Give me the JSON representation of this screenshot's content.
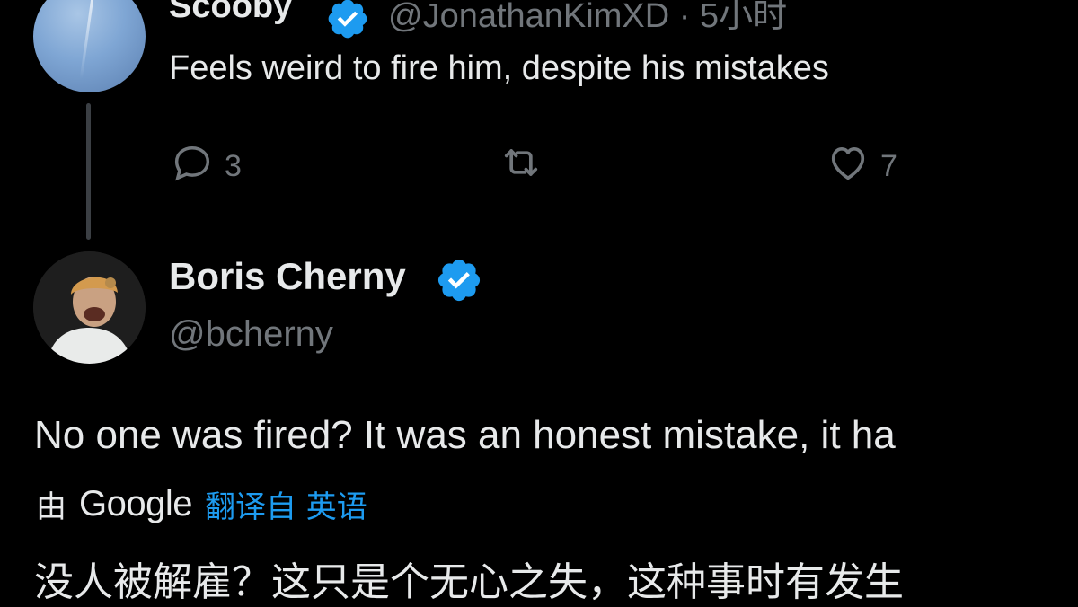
{
  "colors": {
    "background": "#000000",
    "text": "#e7e9ea",
    "muted": "#71767b",
    "link": "#1d9bf0",
    "verified": "#1d9bf0"
  },
  "parent_tweet": {
    "display_name": "Scooby",
    "handle_time": "@JonathanKimXD · 5小时",
    "text": "Feels weird to fire him, despite his mistakes",
    "reply_count": "3",
    "like_count": "7",
    "icons": {
      "verified": "verified-badge-icon",
      "reply": "reply-icon",
      "repost": "repost-icon",
      "like": "heart-icon"
    }
  },
  "reply_tweet": {
    "display_name": "Boris Cherny",
    "handle": "@bcherny",
    "text": "No one was fired? It was an honest mistake, it ha",
    "translation_by": "由",
    "translation_provider": "Google",
    "translation_link": "翻译自 英语",
    "translated_text": "没人被解雇？这只是个无心之失，这种事时有发生"
  }
}
